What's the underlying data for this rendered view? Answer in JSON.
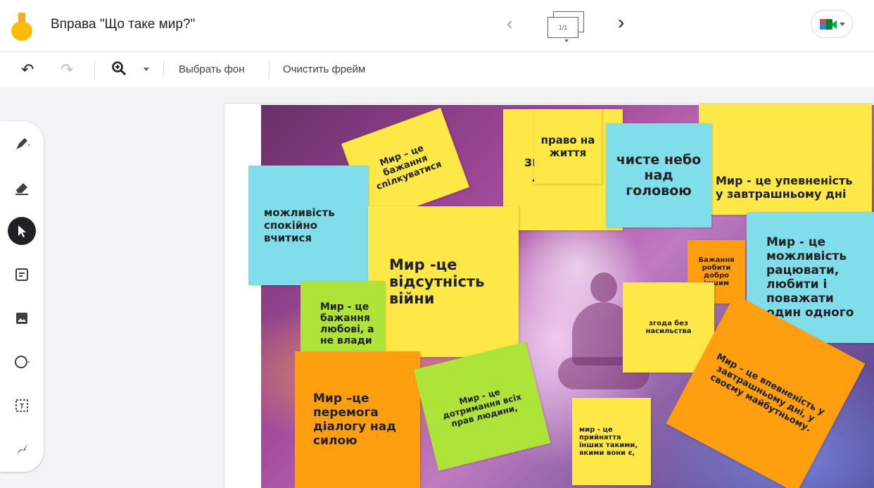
{
  "header": {
    "title": "Вправа \"Що таке мир?\"",
    "frame_counter": "1/1"
  },
  "toolbar": {
    "choose_background": "Выбрать фон",
    "clear_frame": "Очистить фрейм"
  },
  "sidebar": {
    "tools": [
      "pen",
      "eraser",
      "select",
      "sticky-note",
      "image",
      "shape",
      "text-box",
      "laser"
    ],
    "active_tool": "select"
  },
  "notes": {
    "n1": "Мир – це бажання спілкуватися",
    "n2_hidden": "згода між людьми",
    "n3": "право на життя",
    "n4": "чисте небо над головою",
    "n5": "Мир - це упевненість у завтрашньому дні",
    "n6": "можливість спокійно вчитися",
    "n7": "Мир -це відсутність війни",
    "n8": "Бажання робити добро іншим",
    "n9": "Мир - це можливість рацювати, любити і поважати один одного",
    "n10": "Мир - це бажання любові, а не влади",
    "n11": "згода без насильства",
    "n12": "Мир –це перемога діалогу над силою",
    "n13": "Мир - це дотримання всіх прав людини,",
    "n14": "мир - це прийняття інших такими, якими вони є,",
    "n15": "Мир – це впевненість у завтрашньому дні, у своєму майбутньому."
  },
  "colors": {
    "yellow": "#fde847",
    "cyan": "#80deea",
    "green": "#aee33a",
    "orange": "#ff9e0f"
  }
}
